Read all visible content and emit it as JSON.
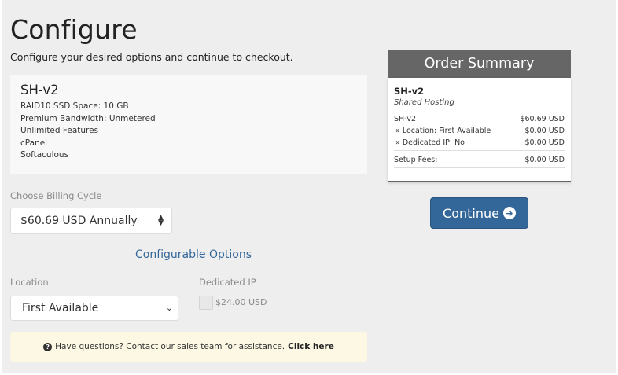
{
  "page": {
    "title": "Configure",
    "subtitle": "Configure your desired options and continue to checkout."
  },
  "product": {
    "name": "SH-v2",
    "features": [
      "RAID10 SSD Space: 10 GB",
      "Premium Bandwidth: Unmetered",
      "Unlimited Features",
      "cPanel",
      "Softaculous"
    ]
  },
  "billing": {
    "label": "Choose Billing Cycle",
    "selected": "$60.69 USD Annually"
  },
  "configurable_options": {
    "heading": "Configurable Options",
    "location_label": "Location",
    "location_selected": "First Available",
    "dedicated_ip_label": "Dedicated IP",
    "dedicated_ip_price": "$24.00 USD"
  },
  "help": {
    "icon": "question-circle-icon",
    "text": "Have questions? Contact our sales team for assistance.",
    "link": "Click here"
  },
  "order_summary": {
    "heading": "Order Summary",
    "product_name": "SH-v2",
    "product_group": "Shared Hosting",
    "lines": [
      {
        "label": "SH-v2",
        "amount": "$60.69 USD"
      },
      {
        "label": "» Location: First Available",
        "amount": "$0.00 USD"
      },
      {
        "label": "» Dedicated IP: No",
        "amount": "$0.00 USD"
      }
    ],
    "setup_label": "Setup Fees:",
    "setup_amount": "$0.00 USD"
  },
  "continue_button": {
    "label": "Continue",
    "icon": "arrow-circle-right-icon"
  },
  "colors": {
    "accent": "#336699",
    "summary_header": "#666666",
    "help_background": "#fcf8e3",
    "page_background": "#eeeeee"
  }
}
